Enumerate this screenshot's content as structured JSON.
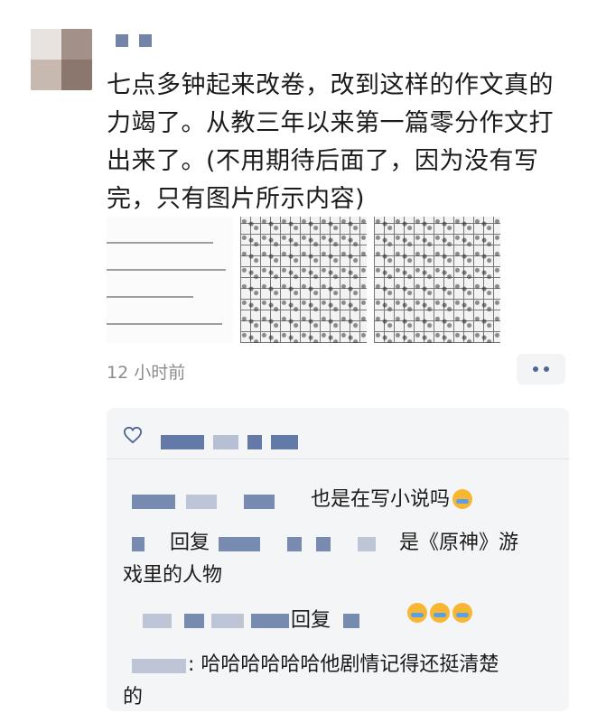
{
  "post": {
    "text": "七点多钟起来改卷，改到这样的作文真的力竭了。从教三年以来第一篇零分作文打出来了。(不用期待后面了，因为没有写完，只有图片所示内容)",
    "time": "12 小时前"
  },
  "images": [
    {
      "icon": "exam-text-thumbnail"
    },
    {
      "icon": "essay-grid-thumbnail"
    },
    {
      "icon": "essay-grid-thumbnail"
    }
  ],
  "comments": [
    {
      "text": "也是在写小说吗",
      "emoji": "crying-laughing-emoji"
    },
    {
      "reply_label": "回复",
      "text_a": "是《原神》游",
      "text_b": "戏里的人物"
    },
    {
      "reply_label": "回复",
      "emoji_count": 3
    },
    {
      "text_a": ": 哈哈哈哈哈哈他剧情记得还挺清楚",
      "text_b": "的"
    }
  ],
  "colors": {
    "accent": "#4f6693",
    "panel_bg": "#f4f5f7",
    "time_gray": "#8c8c8c"
  }
}
